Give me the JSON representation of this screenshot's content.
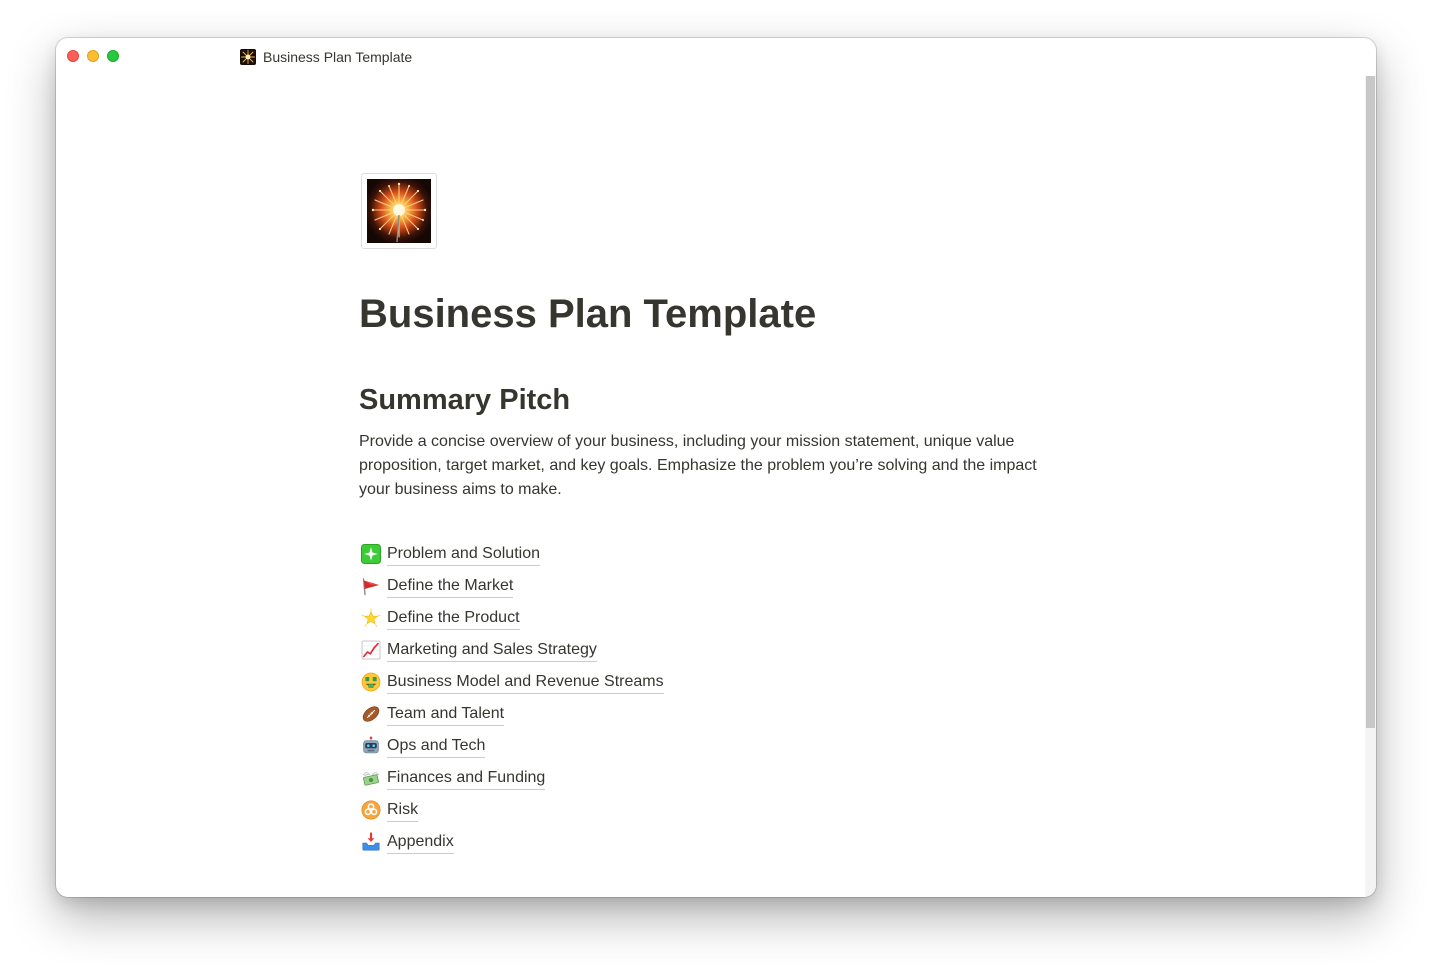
{
  "window": {
    "title": "Business Plan Template"
  },
  "page": {
    "icon": "fireworks-icon",
    "title": "Business Plan Template"
  },
  "summary": {
    "heading": "Summary Pitch",
    "body": "Provide a concise overview of your business, including your mission statement, unique value proposition, target market, and key goals. Emphasize the problem you’re solving and the impact your business aims to make."
  },
  "links": [
    {
      "icon": "sparkle-icon",
      "label": "Problem and Solution"
    },
    {
      "icon": "triangular-flag-icon",
      "label": "Define the Market"
    },
    {
      "icon": "glowing-star-icon",
      "label": "Define the Product"
    },
    {
      "icon": "chart-increasing-icon",
      "label": "Marketing and Sales Strategy"
    },
    {
      "icon": "money-mouth-face-icon",
      "label": "Business Model and Revenue Streams"
    },
    {
      "icon": "football-icon",
      "label": "Team and Talent"
    },
    {
      "icon": "robot-icon",
      "label": "Ops and Tech"
    },
    {
      "icon": "money-with-wings-icon",
      "label": "Finances and Funding"
    },
    {
      "icon": "biohazard-icon",
      "label": "Risk"
    },
    {
      "icon": "inbox-tray-icon",
      "label": "Appendix"
    }
  ],
  "colors": {
    "text": "#37352f",
    "traffic_close": "#fe5f57",
    "traffic_minimize": "#febc2e",
    "traffic_maximize": "#28c840",
    "scrollbar_thumb": "#c7c7c7"
  }
}
